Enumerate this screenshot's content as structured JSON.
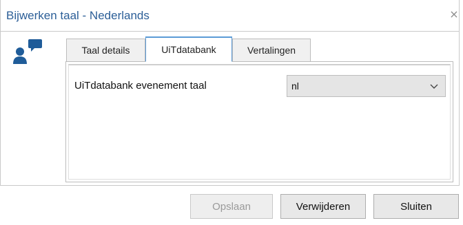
{
  "dialog": {
    "title": "Bijwerken taal - Nederlands",
    "close_glyph": "×",
    "icon": "chat-person-icon"
  },
  "tabs": [
    {
      "label": "Taal details",
      "active": false
    },
    {
      "label": "UiTdatabank",
      "active": true
    },
    {
      "label": "Vertalingen",
      "active": false
    }
  ],
  "form": {
    "field_label": "UiTdatabank evenement taal",
    "select_value": "nl"
  },
  "buttons": {
    "save": {
      "label": "Opslaan",
      "enabled": false
    },
    "delete": {
      "label": "Verwijderen",
      "enabled": true
    },
    "close": {
      "label": "Sluiten",
      "enabled": true
    }
  },
  "colors": {
    "accent": "#2b5e97",
    "tab_active_border": "#5a9ad6"
  }
}
